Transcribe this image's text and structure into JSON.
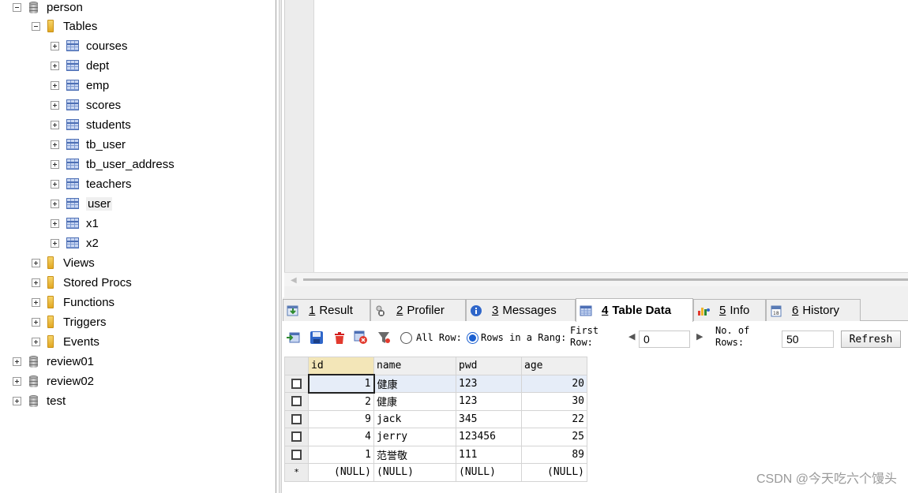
{
  "tree": {
    "database": "person",
    "tables_folder": "Tables",
    "tables": [
      "courses",
      "dept",
      "emp",
      "scores",
      "students",
      "tb_user",
      "tb_user_address",
      "teachers",
      "user",
      "x1",
      "x2"
    ],
    "selected_table": "user",
    "folders": [
      "Views",
      "Stored Procs",
      "Functions",
      "Triggers",
      "Events"
    ],
    "other_databases": [
      "review01",
      "review02",
      "test"
    ]
  },
  "tabs": [
    {
      "num": "1",
      "label": "Result",
      "icon": "result-icon"
    },
    {
      "num": "2",
      "label": "Profiler",
      "icon": "profiler-icon"
    },
    {
      "num": "3",
      "label": "Messages",
      "icon": "messages-icon"
    },
    {
      "num": "4",
      "label": "Table Data",
      "icon": "table-data-icon",
      "active": true
    },
    {
      "num": "5",
      "label": "Info",
      "icon": "info-icon"
    },
    {
      "num": "6",
      "label": "History",
      "icon": "history-icon"
    }
  ],
  "toolbar": {
    "all_rows_label": "All Row:",
    "rows_range_label": "Rows in a Rang:",
    "rows_range_selected": true,
    "first_row_label_1": "First",
    "first_row_label_2": "Row:",
    "first_row_value": "0",
    "no_rows_label_1": "No. of",
    "no_rows_label_2": "Rows:",
    "no_rows_value": "50",
    "refresh_label": "Refresh"
  },
  "grid": {
    "columns": [
      "id",
      "name",
      "pwd",
      "age"
    ],
    "rows": [
      {
        "id": "1",
        "name": "健康",
        "pwd": "123",
        "age": "20"
      },
      {
        "id": "2",
        "name": "健康",
        "pwd": "123",
        "age": "30"
      },
      {
        "id": "9",
        "name": "jack",
        "pwd": "345",
        "age": "22"
      },
      {
        "id": "4",
        "name": "jerry",
        "pwd": "123456",
        "age": "25"
      },
      {
        "id": "1",
        "name": "范誉敬",
        "pwd": "111",
        "age": "89"
      }
    ],
    "new_row_marker": "*",
    "null_text": "(NULL)"
  },
  "watermark": "CSDN @今天吃六个馒头"
}
